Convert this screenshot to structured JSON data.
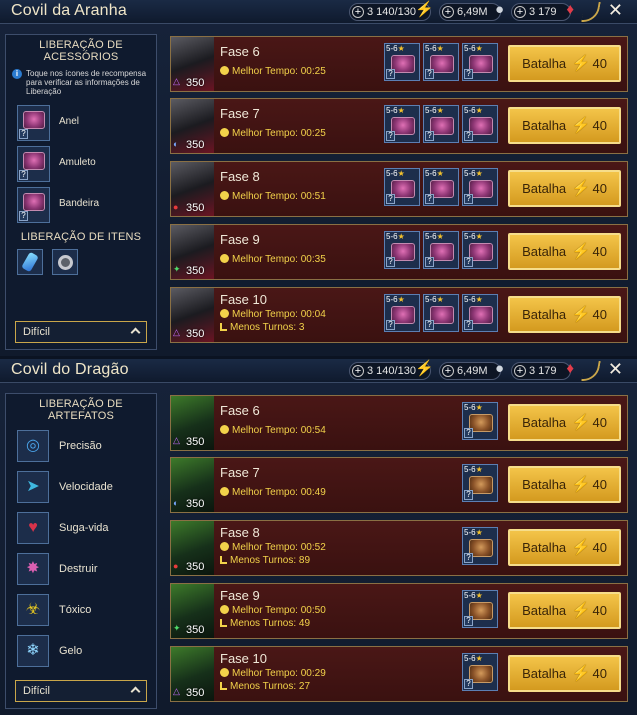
{
  "top": {
    "title": "Covil da Aranha",
    "resources": {
      "energy": "3 140/130",
      "silver": "6,49M",
      "gems": "3 179"
    },
    "sidebar": {
      "heading": "LIBERAÇÃO DE ACESSÓRIOS",
      "info": "Toque nos ícones de recompensa para verificar as informações de Liberação",
      "accessories": [
        "Anel",
        "Amuleto",
        "Bandeira"
      ],
      "items_heading": "LIBERAÇÃO DE ITENS",
      "difficulty": "Difícil"
    },
    "stages": [
      {
        "name": "Fase 6",
        "best": "Melhor Tempo: 00:25",
        "turns": "",
        "level": "350",
        "affinity": "magic"
      },
      {
        "name": "Fase 7",
        "best": "Melhor Tempo: 00:25",
        "turns": "",
        "level": "350",
        "affinity": "void"
      },
      {
        "name": "Fase 8",
        "best": "Melhor Tempo: 00:51",
        "turns": "",
        "level": "350",
        "affinity": "force"
      },
      {
        "name": "Fase 9",
        "best": "Melhor Tempo: 00:35",
        "turns": "",
        "level": "350",
        "affinity": "spirit"
      },
      {
        "name": "Fase 10",
        "best": "Melhor Tempo: 00:04",
        "turns": "Menos Turnos: 3",
        "level": "350",
        "affinity": "magic"
      }
    ],
    "reward_tier": "5-6",
    "battle_label": "Batalha",
    "battle_cost": "40"
  },
  "bottom": {
    "title": "Covil do Dragão",
    "resources": {
      "energy": "3 140/130",
      "silver": "6,49M",
      "gems": "3 179"
    },
    "sidebar": {
      "heading": "LIBERAÇÃO DE ARTEFATOS",
      "sets": [
        {
          "label": "Precisão",
          "icon": "accuracy-icon",
          "glyph": "◎",
          "color": "#4aa3e8"
        },
        {
          "label": "Velocidade",
          "icon": "speed-icon",
          "glyph": "➤",
          "color": "#3fb8e0"
        },
        {
          "label": "Suga-vida",
          "icon": "lifesteal-icon",
          "glyph": "♥",
          "color": "#d8334a"
        },
        {
          "label": "Destruir",
          "icon": "destroy-icon",
          "glyph": "✸",
          "color": "#d95fb0"
        },
        {
          "label": "Tóxico",
          "icon": "toxic-icon",
          "glyph": "☣",
          "color": "#e4c622"
        },
        {
          "label": "Gelo",
          "icon": "frost-icon",
          "glyph": "❄",
          "color": "#8fd6ff"
        }
      ],
      "difficulty": "Difícil"
    },
    "stages": [
      {
        "name": "Fase 6",
        "best": "Melhor Tempo: 00:54",
        "turns": "",
        "level": "350",
        "affinity": "magic"
      },
      {
        "name": "Fase 7",
        "best": "Melhor Tempo: 00:49",
        "turns": "",
        "level": "350",
        "affinity": "void"
      },
      {
        "name": "Fase 8",
        "best": "Melhor Tempo: 00:52",
        "turns": "Menos Turnos: 89",
        "level": "350",
        "affinity": "force"
      },
      {
        "name": "Fase 9",
        "best": "Melhor Tempo: 00:50",
        "turns": "Menos Turnos: 49",
        "level": "350",
        "affinity": "spirit"
      },
      {
        "name": "Fase 10",
        "best": "Melhor Tempo: 00:29",
        "turns": "Menos Turnos: 27",
        "level": "350",
        "affinity": "magic"
      }
    ],
    "reward_tier": "5-6",
    "battle_label": "Batalha",
    "battle_cost": "40"
  },
  "colors": {
    "accent_gold": "#c9a64a",
    "battle_button": "#e0ab2c",
    "time_text": "#f2d24a",
    "stage_bg": "#401312"
  }
}
